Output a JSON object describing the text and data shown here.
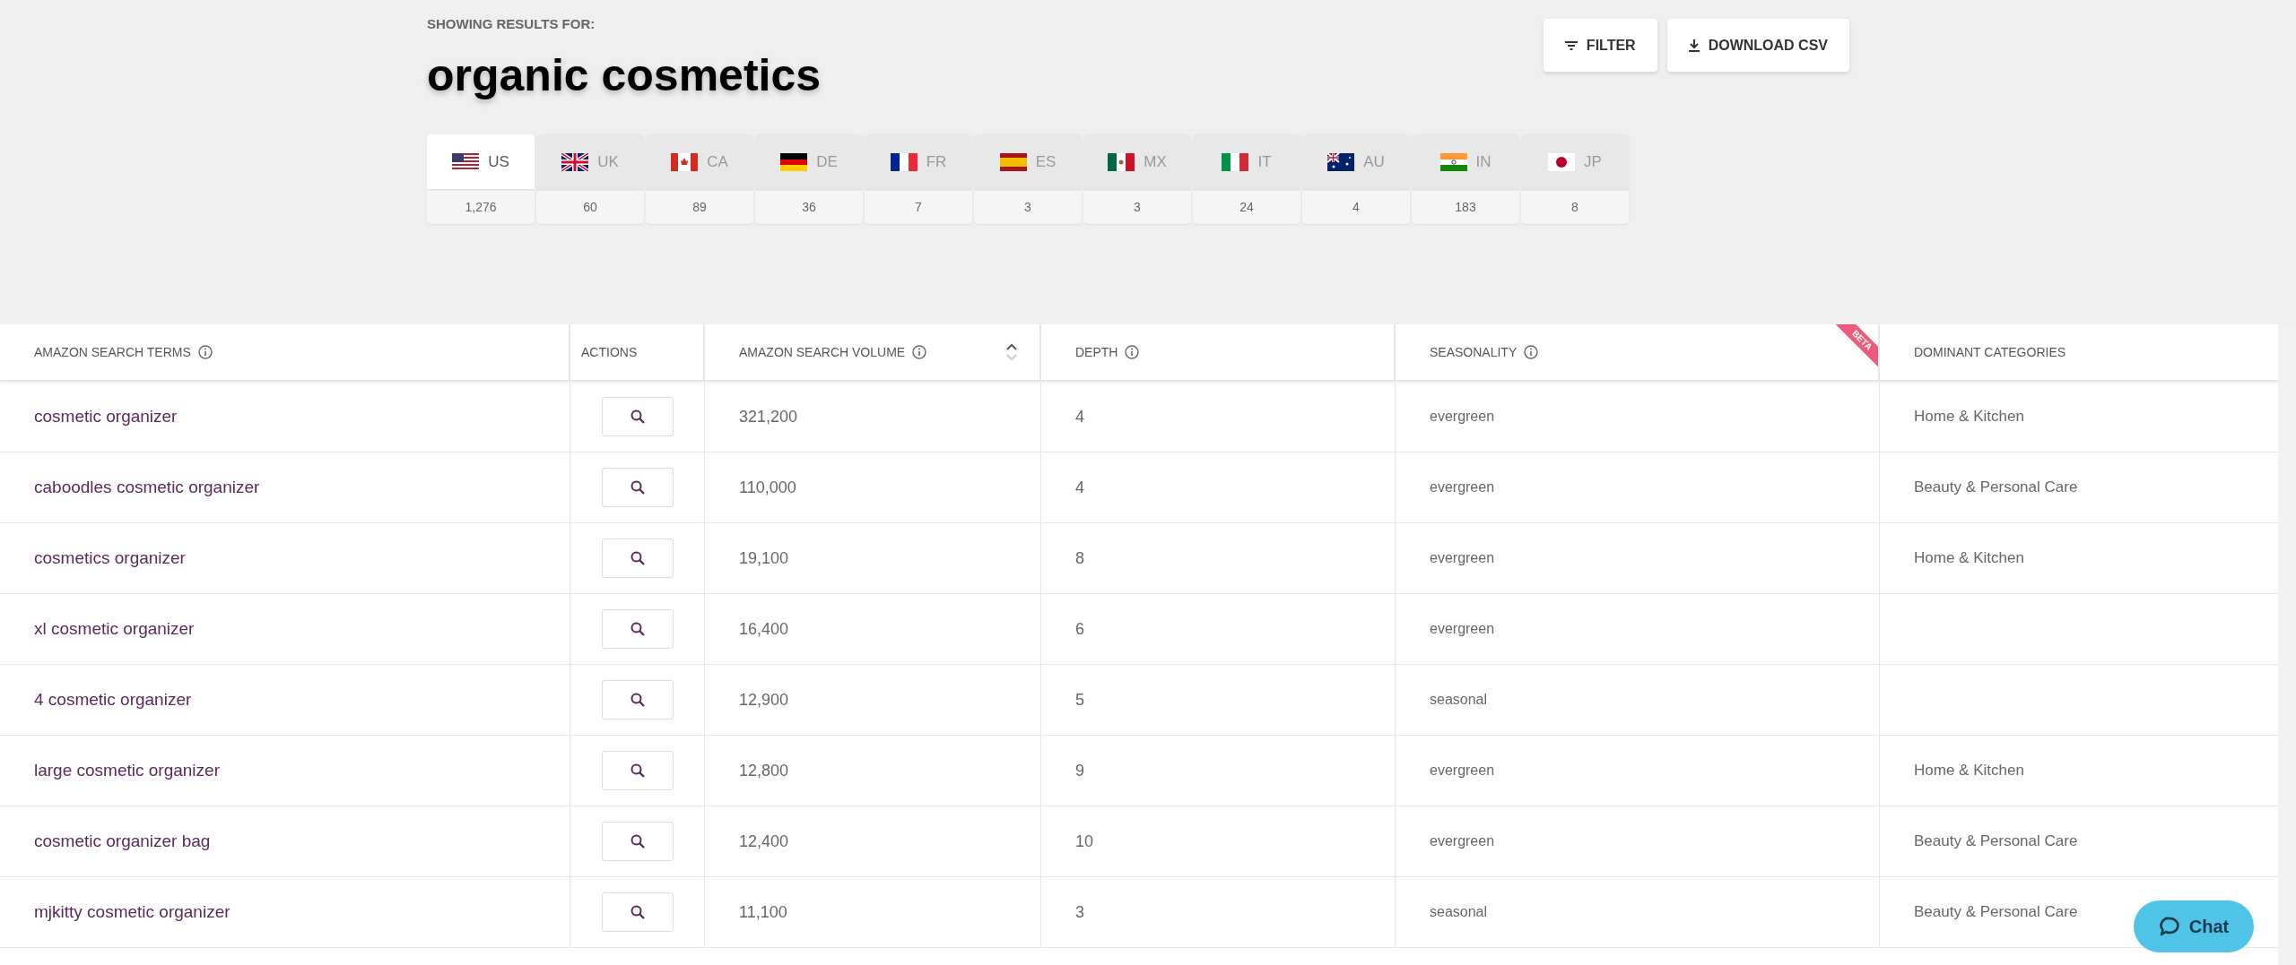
{
  "header": {
    "eyebrow": "SHOWING RESULTS FOR:",
    "query": "organic cosmetics",
    "buttons": [
      {
        "kind": "filter",
        "label": "FILTER"
      },
      {
        "kind": "download",
        "label": "DOWNLOAD CSV"
      }
    ]
  },
  "markets": [
    {
      "code": "US",
      "count": "1,276",
      "selected": true
    },
    {
      "code": "UK",
      "count": "60",
      "selected": false
    },
    {
      "code": "CA",
      "count": "89",
      "selected": false
    },
    {
      "code": "DE",
      "count": "36",
      "selected": false
    },
    {
      "code": "FR",
      "count": "7",
      "selected": false
    },
    {
      "code": "ES",
      "count": "3",
      "selected": false
    },
    {
      "code": "MX",
      "count": "3",
      "selected": false
    },
    {
      "code": "IT",
      "count": "24",
      "selected": false
    },
    {
      "code": "AU",
      "count": "4",
      "selected": false
    },
    {
      "code": "IN",
      "count": "183",
      "selected": false
    },
    {
      "code": "JP",
      "count": "8",
      "selected": false
    }
  ],
  "table": {
    "columns": [
      {
        "label": "AMAZON SEARCH TERMS",
        "info": true
      },
      {
        "label": "ACTIONS",
        "info": false
      },
      {
        "label": "AMAZON SEARCH VOLUME",
        "info": true,
        "sortable": true
      },
      {
        "label": "DEPTH",
        "info": true
      },
      {
        "label": "SEASONALITY",
        "info": true,
        "ribbon": "BETA"
      },
      {
        "label": "DOMINANT CATEGORIES",
        "info": false
      }
    ],
    "rows": [
      {
        "term": "cosmetic organizer",
        "volume": "321,200",
        "depth": "4",
        "seasonality": "evergreen",
        "category": "Home & Kitchen"
      },
      {
        "term": "caboodles cosmetic organizer",
        "volume": "110,000",
        "depth": "4",
        "seasonality": "evergreen",
        "category": "Beauty & Personal Care"
      },
      {
        "term": "cosmetics organizer",
        "volume": "19,100",
        "depth": "8",
        "seasonality": "evergreen",
        "category": "Home & Kitchen"
      },
      {
        "term": "xl cosmetic organizer",
        "volume": "16,400",
        "depth": "6",
        "seasonality": "evergreen"
      },
      {
        "term": "4 cosmetic organizer",
        "volume": "12,900",
        "depth": "5",
        "seasonality": "seasonal"
      },
      {
        "term": "large cosmetic organizer",
        "volume": "12,800",
        "depth": "9",
        "seasonality": "evergreen",
        "category": "Home & Kitchen"
      },
      {
        "term": "cosmetic organizer bag",
        "volume": "12,400",
        "depth": "10",
        "seasonality": "evergreen",
        "category": "Beauty & Personal Care"
      },
      {
        "term": "mjkitty cosmetic organizer",
        "volume": "11,100",
        "depth": "3",
        "seasonality": "seasonal",
        "category": "Beauty & Personal Care"
      }
    ]
  },
  "chat": {
    "label": "Chat"
  }
}
